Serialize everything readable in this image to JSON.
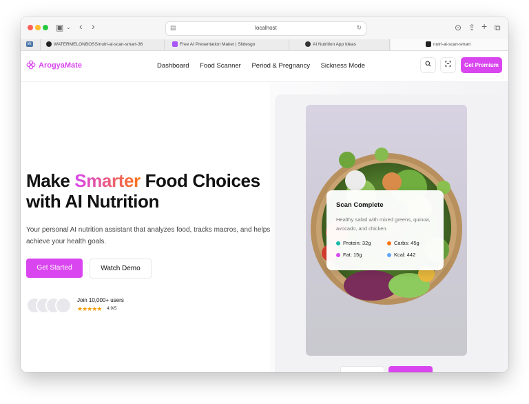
{
  "browser": {
    "url": "localhost",
    "tabs": [
      {
        "label": "",
        "icon": "vk-icon"
      },
      {
        "label": "WATERMELONBOSS/nutri-ai-scan-smart-36",
        "icon": "github-icon"
      },
      {
        "label": "Free AI Presentation Maker | Slidesgo",
        "icon": "slidesgo-icon"
      },
      {
        "label": "AI Nutrition App Ideas",
        "icon": "chatgpt-icon"
      },
      {
        "label": "nutri-ai-scan-smart",
        "icon": "site-icon"
      }
    ]
  },
  "app": {
    "brand": "ArogyaMate",
    "nav": [
      "Dashboard",
      "Food Scanner",
      "Period & Pregnancy",
      "Sickness Mode"
    ],
    "premium_label": "Get Premium",
    "accent_color": "#d946ef"
  },
  "hero": {
    "headline_part1": "Make ",
    "headline_accent": "Smarter",
    "headline_part2": " Food Choices",
    "headline_line2": "with AI Nutrition",
    "subtitle": "Your personal AI nutrition assistant that analyzes food, tracks macros, and helps achieve your health goals.",
    "primary_cta": "Get Started",
    "secondary_cta": "Watch Demo",
    "users_text": "Join 10,000+ users",
    "stars": "★★★★★",
    "rating": "4.9/5"
  },
  "scan_card": {
    "title": "Scan Complete",
    "description": "Healthy salad with mixed greens, quinoa, avocado, and chicken.",
    "macros": [
      {
        "label": "Protein: 32g",
        "color": "#14b8a6"
      },
      {
        "label": "Carbs: 45g",
        "color": "#f97316"
      },
      {
        "label": "Fat: 15g",
        "color": "#d946ef"
      },
      {
        "label": "Kcal: 442",
        "color": "#60a5fa"
      }
    ]
  }
}
